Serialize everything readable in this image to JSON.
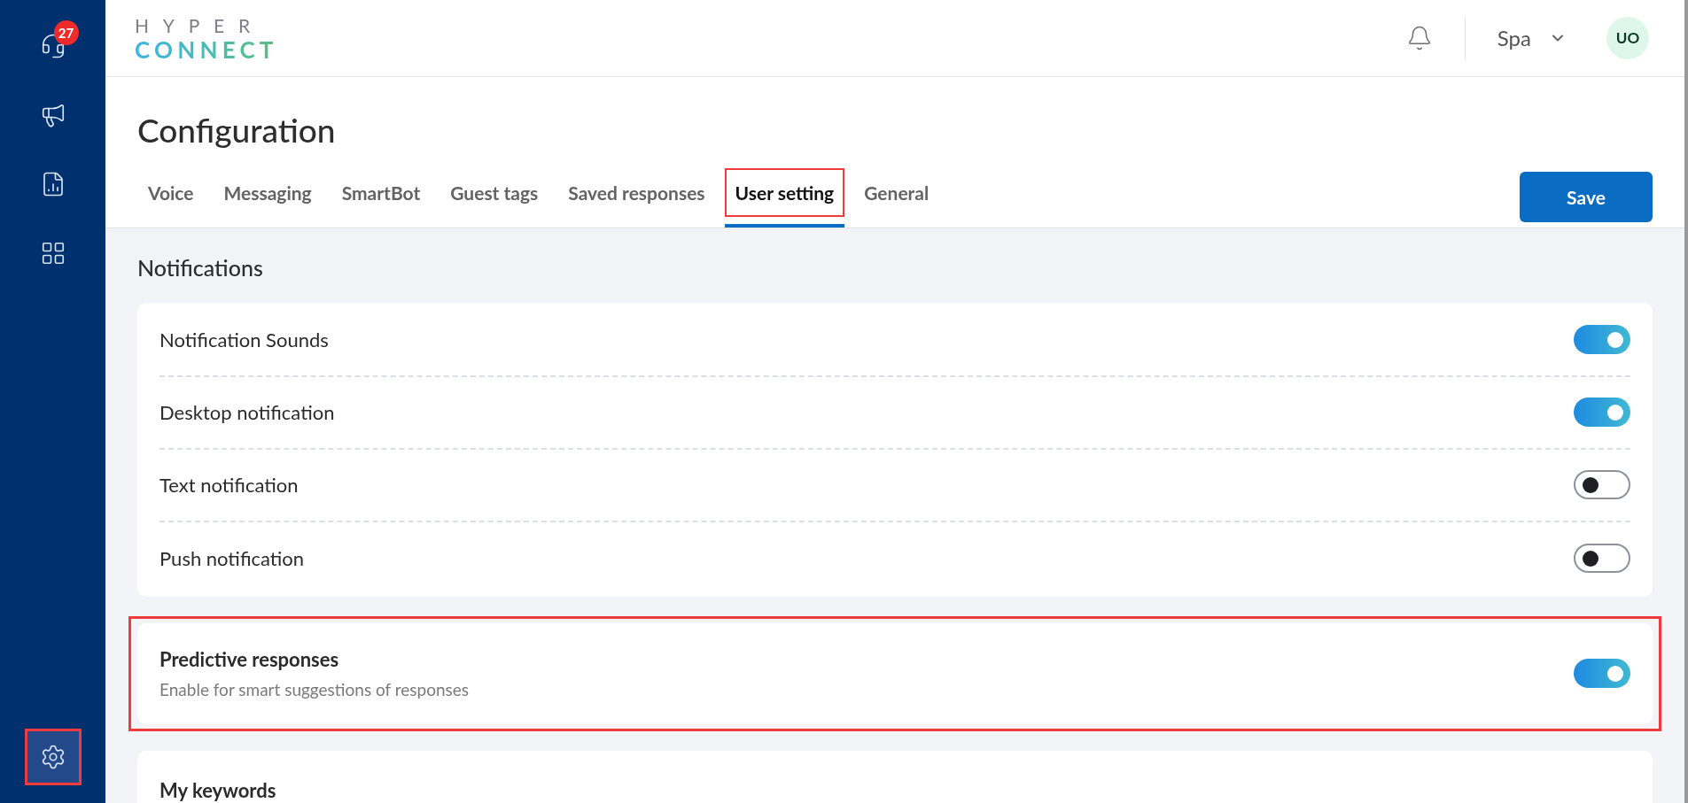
{
  "sidebar": {
    "items": [
      {
        "kind": "support",
        "badge": "27",
        "selected": false,
        "annotated": false
      },
      {
        "kind": "campaigns",
        "selected": false,
        "annotated": false
      },
      {
        "kind": "reports",
        "selected": false,
        "annotated": false
      },
      {
        "kind": "apps",
        "selected": false,
        "annotated": false
      }
    ],
    "bottom_items": [
      {
        "kind": "settings",
        "selected": true,
        "annotated": true
      }
    ]
  },
  "header": {
    "logo": {
      "line_1": "HYPER",
      "line_2": "CONNECT"
    },
    "workspace": "Spa",
    "avatar": "UO"
  },
  "page": {
    "title": "Configuration",
    "save_button": "Save",
    "tabs": [
      {
        "label": "Voice",
        "selected": false,
        "annotated": false
      },
      {
        "label": "Messaging",
        "selected": false,
        "annotated": false
      },
      {
        "label": "SmartBot",
        "selected": false,
        "annotated": false
      },
      {
        "label": "Guest tags",
        "selected": false,
        "annotated": false
      },
      {
        "label": "Saved responses",
        "selected": false,
        "annotated": false
      },
      {
        "label": "User setting",
        "selected": true,
        "annotated": true
      },
      {
        "label": "General",
        "selected": false,
        "annotated": false
      }
    ]
  },
  "section_title": "Notifications",
  "cards": [
    {
      "kind": "list",
      "annotated": false,
      "rows": [
        {
          "label": "Notification Sounds",
          "on": true
        },
        {
          "label": "Desktop notification",
          "on": true
        },
        {
          "label": "Text notification",
          "on": false
        },
        {
          "label": "Push notification",
          "on": false
        }
      ]
    },
    {
      "kind": "toggle",
      "annotated": true,
      "title": "Predictive responses",
      "description": "Enable for smart suggestions of responses",
      "on": true
    },
    {
      "kind": "heading",
      "annotated": false,
      "title": "My keywords"
    }
  ]
}
